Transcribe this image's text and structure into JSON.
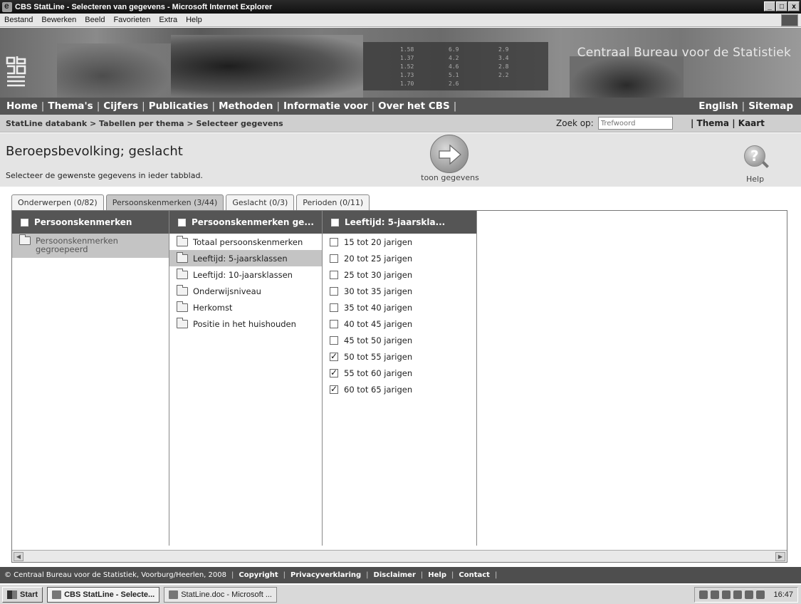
{
  "window": {
    "title": "CBS StatLine - Selecteren van gegevens - Microsoft Internet Explorer",
    "controls": [
      "_",
      "□",
      "x"
    ]
  },
  "menu": [
    "Bestand",
    "Bewerken",
    "Beeld",
    "Favorieten",
    "Extra",
    "Help"
  ],
  "banner": {
    "org_name": "Centraal Bureau voor de Statistiek",
    "screen_values": [
      "1.58",
      "6.9",
      "2.9",
      "1.37",
      "4.2",
      "3.4",
      "1.52",
      "4.6",
      "2.8",
      "1.73",
      "5.1",
      "2.2",
      "1.70",
      "2.6"
    ]
  },
  "nav": {
    "left": [
      "Home",
      "Thema's",
      "Cijfers",
      "Publicaties",
      "Methoden",
      "Informatie voor",
      "Over het CBS"
    ],
    "right": [
      "English",
      "Sitemap"
    ]
  },
  "breadcrumb": "StatLine databank > Tabellen per thema > Selecteer gegevens",
  "search": {
    "label": "Zoek op:",
    "placeholder": "Trefwoord",
    "links": "| Thema | Kaart"
  },
  "page": {
    "title": "Beroepsbevolking; geslacht",
    "subtitle": "Selecteer de gewenste gegevens in ieder tabblad.",
    "show_label": "toon gegevens",
    "help_label": "Help"
  },
  "tabs": [
    {
      "label": "Onderwerpen (0/82)",
      "active": false
    },
    {
      "label": "Persoonskenmerken (3/44)",
      "active": true
    },
    {
      "label": "Geslacht (0/3)",
      "active": false
    },
    {
      "label": "Perioden (0/11)",
      "active": false
    }
  ],
  "columns": {
    "col1": {
      "header": "Persoonskenmerken",
      "items": [
        {
          "label": "Persoonskenmerken gegroepeerd",
          "selected": true
        }
      ]
    },
    "col2": {
      "header": "Persoonskenmerken ge...",
      "items": [
        {
          "label": "Totaal persoonskenmerken",
          "selected": false
        },
        {
          "label": "Leeftijd: 5-jaarsklassen",
          "selected": true
        },
        {
          "label": "Leeftijd: 10-jaarsklassen",
          "selected": false
        },
        {
          "label": "Onderwijsniveau",
          "selected": false
        },
        {
          "label": "Herkomst",
          "selected": false
        },
        {
          "label": "Positie in het huishouden",
          "selected": false
        }
      ]
    },
    "col3": {
      "header": "Leeftijd: 5-jaarskla...",
      "items": [
        {
          "label": "15 tot 20 jarigen",
          "checked": false
        },
        {
          "label": "20 tot 25 jarigen",
          "checked": false
        },
        {
          "label": "25 tot 30 jarigen",
          "checked": false
        },
        {
          "label": "30 tot 35 jarigen",
          "checked": false
        },
        {
          "label": "35 tot 40 jarigen",
          "checked": false
        },
        {
          "label": "40 tot 45 jarigen",
          "checked": false
        },
        {
          "label": "45 tot 50 jarigen",
          "checked": false
        },
        {
          "label": "50 tot 55 jarigen",
          "checked": true
        },
        {
          "label": "55 tot 60 jarigen",
          "checked": true
        },
        {
          "label": "60 tot 65 jarigen",
          "checked": true
        }
      ]
    }
  },
  "footer": {
    "copyright": "© Centraal Bureau voor de Statistiek, Voorburg/Heerlen, 2008",
    "links": [
      "Copyright",
      "Privacyverklaring",
      "Disclaimer",
      "Help",
      "Contact"
    ]
  },
  "taskbar": {
    "start": "Start",
    "buttons": [
      {
        "label": "CBS StatLine - Selecte...",
        "active": true
      },
      {
        "label": "StatLine.doc - Microsoft ...",
        "active": false
      }
    ],
    "clock": "16:47"
  }
}
